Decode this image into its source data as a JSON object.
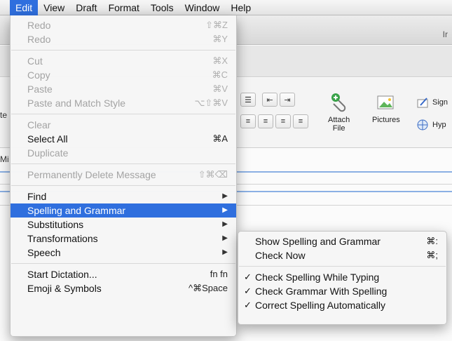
{
  "menubar": {
    "items": [
      "Edit",
      "View",
      "Draft",
      "Format",
      "Tools",
      "Window",
      "Help"
    ]
  },
  "background": {
    "title_fragment": "Ir",
    "left_fragments": [
      "te",
      "Mi"
    ],
    "ribbon": {
      "attach_label": "Attach\nFile",
      "pictures_label": "Pictures",
      "signature_label": "Sign",
      "hyperlink_label": "Hyp"
    }
  },
  "edit_menu": {
    "groups": [
      [
        {
          "label": "Redo",
          "shortcut": "⇧⌘Z",
          "enabled": false
        },
        {
          "label": "Redo",
          "shortcut": "⌘Y",
          "enabled": false
        }
      ],
      [
        {
          "label": "Cut",
          "shortcut": "⌘X",
          "enabled": false
        },
        {
          "label": "Copy",
          "shortcut": "⌘C",
          "enabled": false
        },
        {
          "label": "Paste",
          "shortcut": "⌘V",
          "enabled": false
        },
        {
          "label": "Paste and Match Style",
          "shortcut": "⌥⇧⌘V",
          "enabled": false
        }
      ],
      [
        {
          "label": "Clear",
          "shortcut": "",
          "enabled": false
        },
        {
          "label": "Select All",
          "shortcut": "⌘A",
          "enabled": true
        },
        {
          "label": "Duplicate",
          "shortcut": "",
          "enabled": false
        }
      ],
      [
        {
          "label": "Permanently Delete Message",
          "shortcut": "⇧⌘⌫",
          "enabled": false
        }
      ],
      [
        {
          "label": "Find",
          "shortcut": "",
          "enabled": true,
          "submenu": true
        },
        {
          "label": "Spelling and Grammar",
          "shortcut": "",
          "enabled": true,
          "submenu": true,
          "highlighted": true
        },
        {
          "label": "Substitutions",
          "shortcut": "",
          "enabled": true,
          "submenu": true
        },
        {
          "label": "Transformations",
          "shortcut": "",
          "enabled": true,
          "submenu": true
        },
        {
          "label": "Speech",
          "shortcut": "",
          "enabled": true,
          "submenu": true
        }
      ],
      [
        {
          "label": "Start Dictation...",
          "shortcut": "fn fn",
          "enabled": true
        },
        {
          "label": "Emoji & Symbols",
          "shortcut": "^⌘Space",
          "enabled": true
        }
      ]
    ]
  },
  "spelling_submenu": {
    "groups": [
      [
        {
          "label": "Show Spelling and Grammar",
          "shortcut": "⌘:",
          "checked": false
        },
        {
          "label": "Check Now",
          "shortcut": "⌘;",
          "checked": false
        }
      ],
      [
        {
          "label": "Check Spelling While Typing",
          "shortcut": "",
          "checked": true
        },
        {
          "label": "Check Grammar With Spelling",
          "shortcut": "",
          "checked": true
        },
        {
          "label": "Correct Spelling Automatically",
          "shortcut": "",
          "checked": true
        }
      ]
    ],
    "check_glyph": "✓",
    "arrow_glyph": "▶"
  },
  "colors": {
    "highlight": "#2f6fde"
  }
}
